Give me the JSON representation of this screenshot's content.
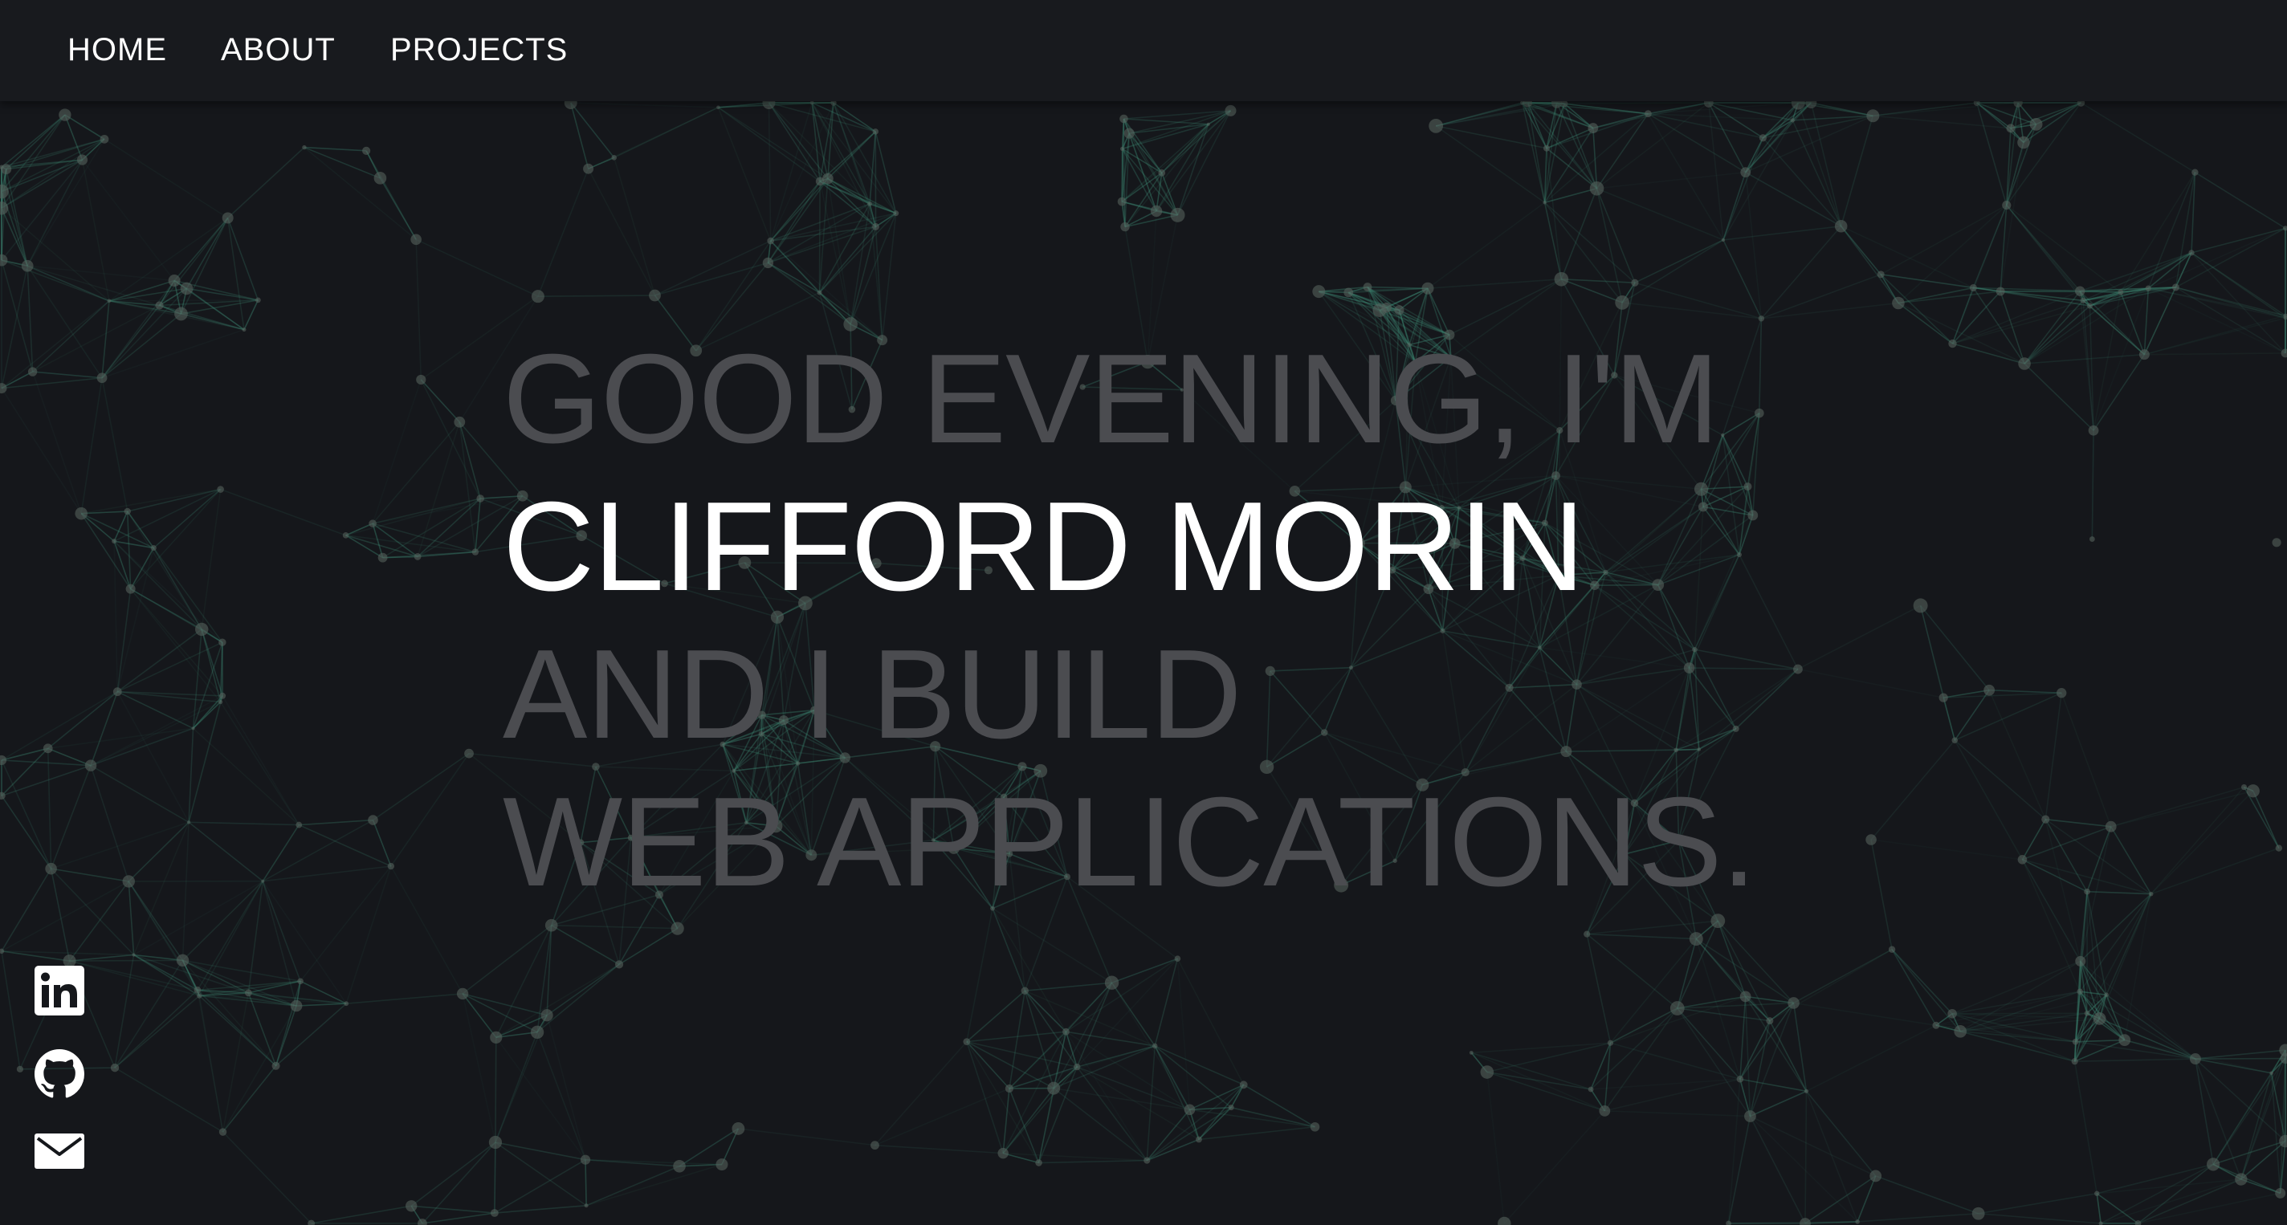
{
  "nav": {
    "items": [
      {
        "label": "HOME"
      },
      {
        "label": "ABOUT"
      },
      {
        "label": "PROJECTS"
      }
    ]
  },
  "hero": {
    "greeting": "GOOD EVENING, I'M",
    "name": "CLIFFORD MORIN",
    "line3": "AND I BUILD",
    "line4": "WEB APPLICATIONS."
  },
  "social": [
    {
      "icon": "linkedin-icon"
    },
    {
      "icon": "github-icon"
    },
    {
      "icon": "mail-icon"
    }
  ],
  "colors": {
    "background": "#15171b",
    "navbar": "#181a1e",
    "dim_text": "#4b4c50",
    "highlight_text": "#ffffff",
    "network_lines": "#3f8f78",
    "network_nodes": "#55605c"
  }
}
